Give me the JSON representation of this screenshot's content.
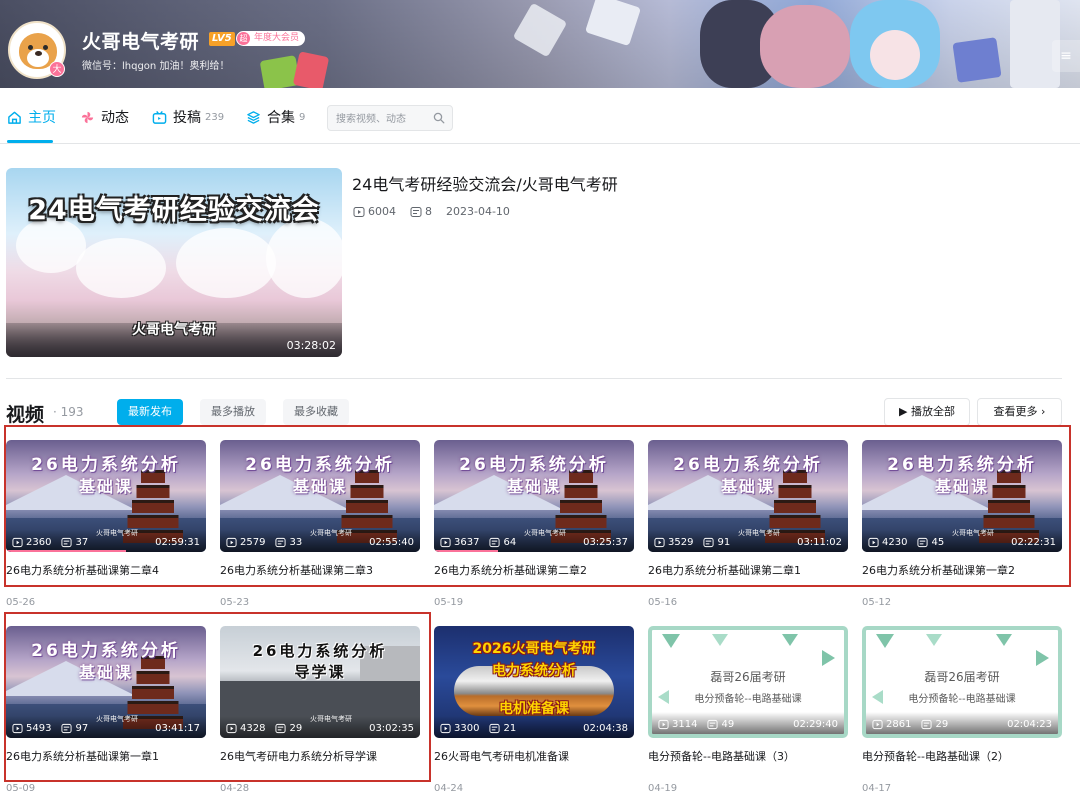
{
  "user": {
    "name": "火哥电气考研",
    "level": "LV5",
    "vip_badge_icon": "超",
    "vip_label": "年度大会员",
    "avatar_badge": "大",
    "signature": "微信号：lhqgon 加油！奥利给！"
  },
  "nav": {
    "items": [
      {
        "label": "主页",
        "count": ""
      },
      {
        "label": "动态",
        "count": ""
      },
      {
        "label": "投稿",
        "count": "239"
      },
      {
        "label": "合集",
        "count": "9"
      }
    ],
    "search_placeholder": "搜索视频、动态"
  },
  "featured": {
    "thumb_title": "24电气考研经验交流会",
    "thumb_subtitle": "火哥电气考研",
    "duration": "03:28:02",
    "title": "24电气考研经验交流会/火哥电气考研",
    "views": "6004",
    "comments": "8",
    "date": "2023-04-10"
  },
  "videos_section": {
    "title": "视频",
    "count": "193",
    "tabs": [
      "最新发布",
      "最多播放",
      "最多收藏"
    ],
    "play_all": "播放全部",
    "view_more": "查看更多 ›"
  },
  "videos": [
    {
      "thumb_line1": "26电力系统分析",
      "thumb_line2": "基础课",
      "watermark": "火哥电气考研",
      "views": "2360",
      "comments": "37",
      "duration": "02:59:31",
      "title": "26电力系统分析基础课第二章4",
      "date": "05-26",
      "progress": 0.6
    },
    {
      "thumb_line1": "26电力系统分析",
      "thumb_line2": "基础课",
      "watermark": "火哥电气考研",
      "views": "2579",
      "comments": "33",
      "duration": "02:55:40",
      "title": "26电力系统分析基础课第二章3",
      "date": "05-23",
      "progress": 0.0
    },
    {
      "thumb_line1": "26电力系统分析",
      "thumb_line2": "基础课",
      "watermark": "火哥电气考研",
      "views": "3637",
      "comments": "64",
      "duration": "03:25:37",
      "title": "26电力系统分析基础课第二章2",
      "date": "05-19",
      "progress": 0.32
    },
    {
      "thumb_line1": "26电力系统分析",
      "thumb_line2": "基础课",
      "watermark": "火哥电气考研",
      "views": "3529",
      "comments": "91",
      "duration": "03:11:02",
      "title": "26电力系统分析基础课第二章1",
      "date": "05-16",
      "progress": 0.0
    },
    {
      "thumb_line1": "26电力系统分析",
      "thumb_line2": "基础课",
      "watermark": "火哥电气考研",
      "views": "4230",
      "comments": "45",
      "duration": "02:22:31",
      "title": "26电力系统分析基础课第一章2",
      "date": "05-12",
      "progress": 0.0
    },
    {
      "thumb_line1": "26电力系统分析",
      "thumb_line2": "基础课",
      "watermark": "火哥电气考研",
      "views": "5493",
      "comments": "97",
      "duration": "03:41:17",
      "title": "26电力系统分析基础课第一章1",
      "date": "05-09",
      "progress": 0.0
    },
    {
      "thumb_line1": "26电力系统分析",
      "thumb_line2": "导学课",
      "watermark": "火哥电气考研",
      "views": "4328",
      "comments": "29",
      "duration": "03:02:35",
      "title": "26电气考研电力系统分析导学课",
      "date": "04-28",
      "progress": 0.0
    },
    {
      "thumb_line1": "2026火哥电气考研",
      "thumb_line2": "电力系统分析",
      "thumb_line3": "电机准备课",
      "views": "3300",
      "comments": "21",
      "duration": "02:04:38",
      "title": "26火哥电气考研电机准备课",
      "date": "04-24",
      "progress": 0.0
    },
    {
      "thumb_line1": "磊哥26届考研",
      "thumb_line2": "电分预备轮--电路基础课",
      "views": "3114",
      "comments": "49",
      "duration": "02:29:40",
      "title": "电分预备轮--电路基础课（3）",
      "date": "04-19",
      "progress": 0.0
    },
    {
      "thumb_line1": "磊哥26届考研",
      "thumb_line2": "电分预备轮--电路基础课",
      "views": "2861",
      "comments": "29",
      "duration": "02:04:23",
      "title": "电分预备轮--电路基础课（2）",
      "date": "04-17",
      "progress": 0.0
    }
  ],
  "colors": {
    "accent": "#00aeec",
    "highlight_box": "#c8332b",
    "vip": "#fb7299"
  }
}
